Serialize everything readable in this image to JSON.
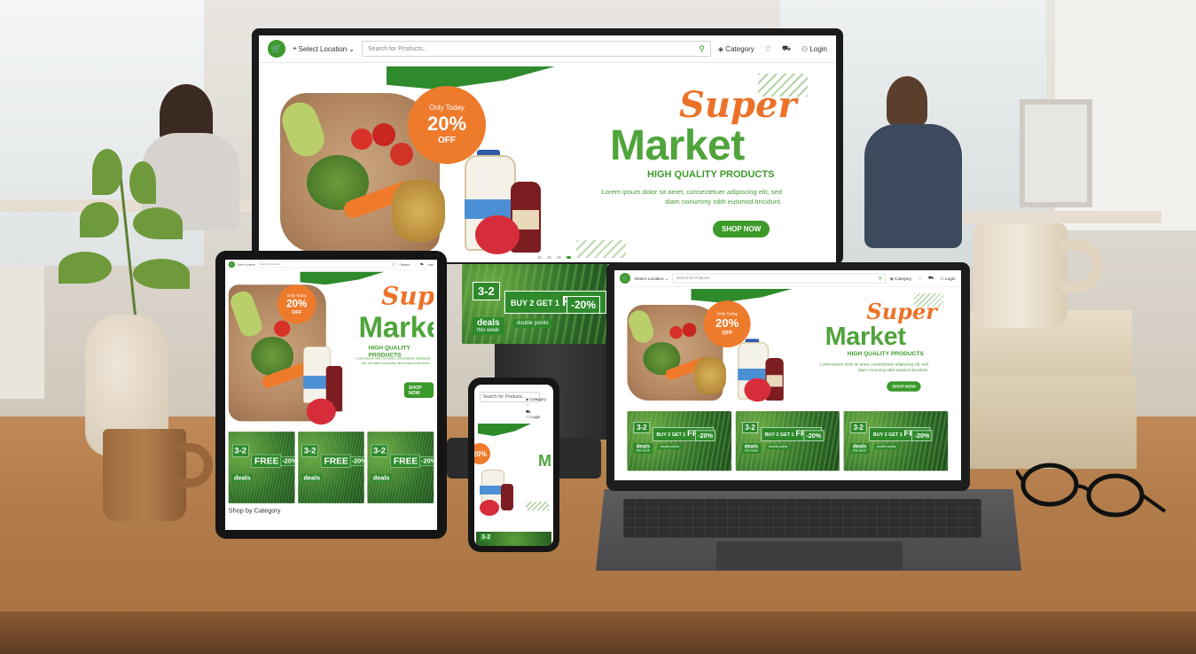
{
  "site": {
    "location_label": "Select Location",
    "search_placeholder": "Search for Products...",
    "category_label": "Category",
    "login_label": "Login",
    "badge_line1": "Only Today",
    "badge_percent": "20%",
    "badge_off": "OFF",
    "title_super": "Super",
    "title_market": "Market",
    "tagline": "HIGH QUALITY PRODUCTS",
    "lorem": "Lorem ipsum dolor sit amet, consectetuer adipiscing elit, sed diam nonummy nibh euismod tincidunt.",
    "shop_now": "SHOP NOW",
    "promo": {
      "three_for_two": "3-2",
      "buy_get": "BUY 2 GET 1",
      "free": "FREE",
      "percent": "-20%",
      "deals": "deals",
      "this_week": "this week",
      "double_points": "double points"
    },
    "shop_by_category": "Shop by Category"
  },
  "colors": {
    "brand_green": "#3c9a2a",
    "accent_orange": "#ec7229"
  }
}
